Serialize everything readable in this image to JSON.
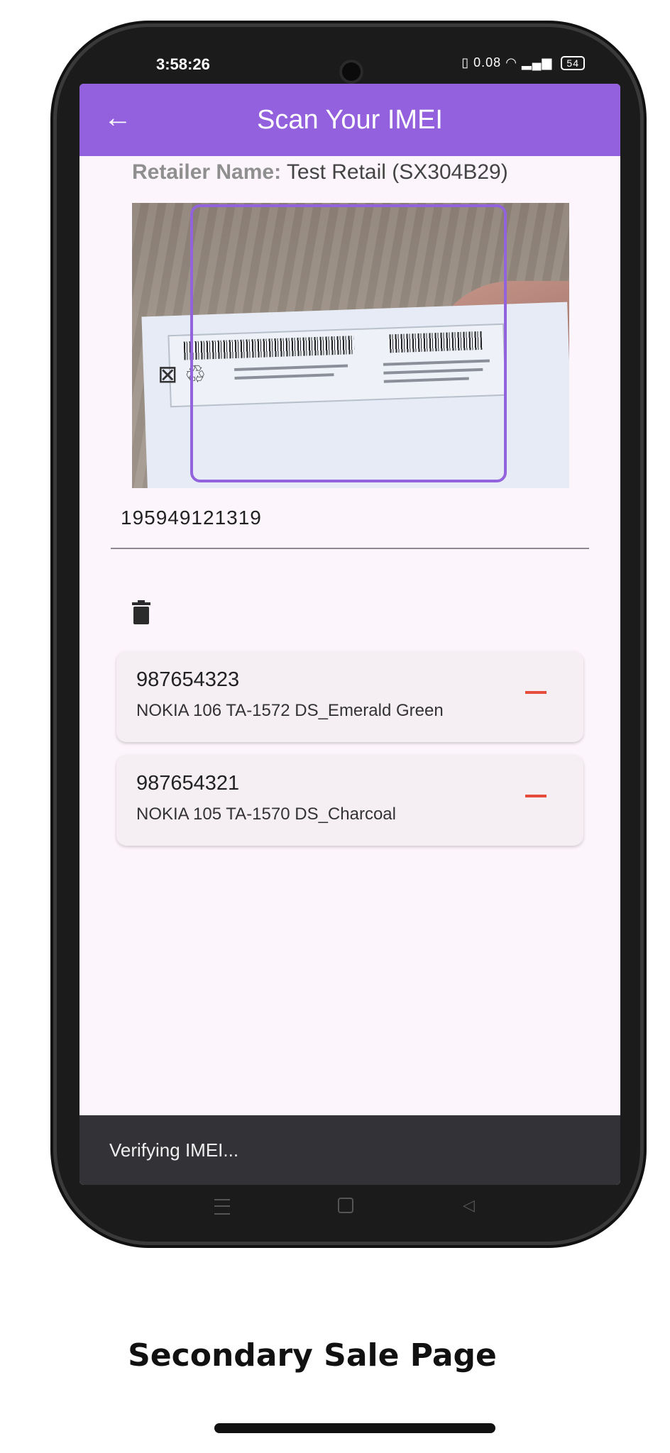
{
  "status_bar": {
    "time": "3:58:26",
    "net_speed": "0.08",
    "net_unit": "KB/S",
    "battery": "54"
  },
  "app_bar": {
    "title": "Scan Your IMEI",
    "back_icon": "arrow-left-icon"
  },
  "retailer": {
    "label": "Retailer Name:",
    "value": "Test Retail (SX304B29)"
  },
  "scanner": {
    "scanned_value": "195949121319"
  },
  "list": {
    "delete_icon": "trash-icon",
    "items": [
      {
        "imei": "987654323",
        "product": "NOKIA 106 TA-1572 DS_Emerald Green"
      },
      {
        "imei": "987654321",
        "product": "NOKIA 105 TA-1570 DS_Charcoal"
      }
    ],
    "remove_color": "#e74b3c"
  },
  "snackbar": {
    "message": "Verifying IMEI..."
  },
  "caption": "Secondary Sale Page",
  "colors": {
    "primary": "#9360de",
    "background": "#fcf5fb"
  }
}
